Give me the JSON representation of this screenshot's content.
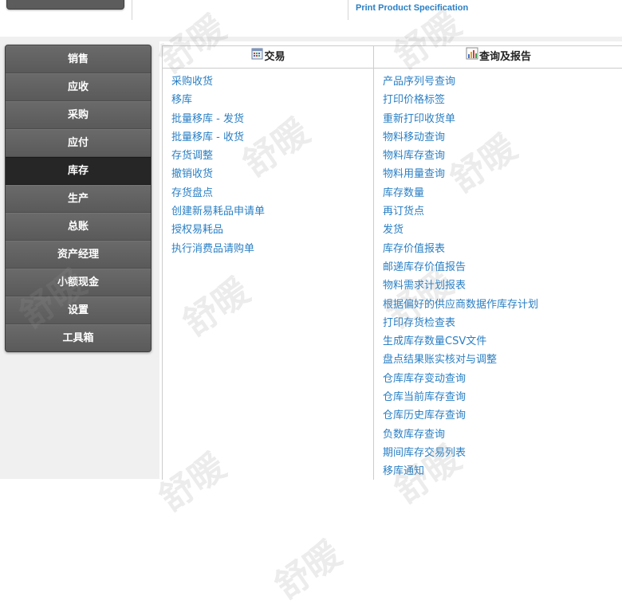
{
  "top": {
    "link_label": "Print Product Specification"
  },
  "menu": {
    "items": [
      {
        "label": "销售",
        "active": false
      },
      {
        "label": "应收",
        "active": false
      },
      {
        "label": "采购",
        "active": false
      },
      {
        "label": "应付",
        "active": false
      },
      {
        "label": "库存",
        "active": true
      },
      {
        "label": "生产",
        "active": false
      },
      {
        "label": "总账",
        "active": false
      },
      {
        "label": "资产经理",
        "active": false
      },
      {
        "label": "小额现金",
        "active": false
      },
      {
        "label": "设置",
        "active": false
      },
      {
        "label": "工具箱",
        "active": false
      }
    ]
  },
  "transactions": {
    "title": "交易",
    "icon": "transactions-icon",
    "links": [
      "采购收货",
      "移库",
      "批量移库 - 发货",
      "批量移库 - 收货",
      "存货调整",
      "撤销收货",
      "存货盘点",
      "创建新易耗品申请单",
      "授权易耗品",
      "执行消费品请购单"
    ]
  },
  "reports": {
    "title": "查询及报告",
    "icon": "reports-chart-icon",
    "links": [
      "产品序列号查询",
      "打印价格标签",
      "重新打印收货单",
      "物料移动查询",
      "物料库存查询",
      "物料用量查询",
      "库存数量",
      "再订货点",
      "发货",
      "库存价值报表",
      "邮递库存价值报告",
      "物料需求计划报表",
      "根据偏好的供应商数据作库存计划",
      "打印存货检查表",
      "生成库存数量CSV文件",
      "盘点结果账实核对与调整",
      "仓库库存变动查询",
      "仓库当前库存查询",
      "仓库历史库存查询",
      "负数库存查询",
      "期间库存交易列表",
      "移库通知"
    ]
  },
  "watermark_text": "舒暖",
  "colors": {
    "link": "#2a7fc4",
    "menu_bg": "#616161",
    "menu_active": "#262626"
  }
}
